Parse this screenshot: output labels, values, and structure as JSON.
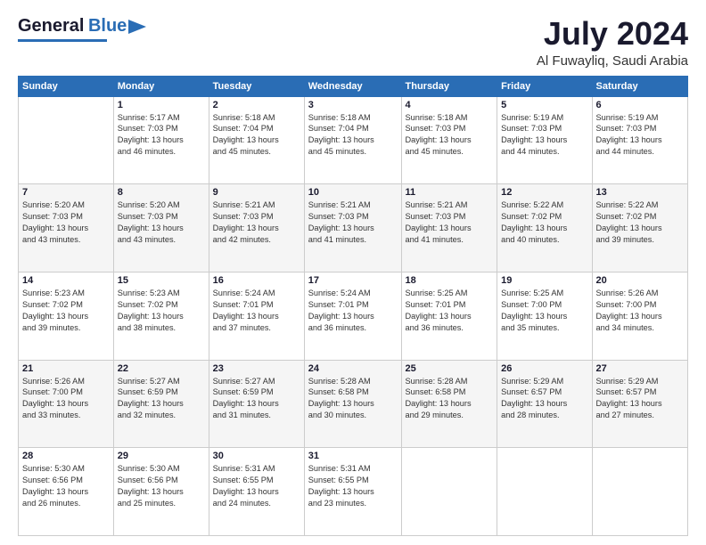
{
  "header": {
    "logo_line1": "General",
    "logo_line2": "Blue",
    "month": "July 2024",
    "location": "Al Fuwayliq, Saudi Arabia"
  },
  "days_of_week": [
    "Sunday",
    "Monday",
    "Tuesday",
    "Wednesday",
    "Thursday",
    "Friday",
    "Saturday"
  ],
  "weeks": [
    [
      {
        "day": "",
        "info": ""
      },
      {
        "day": "1",
        "info": "Sunrise: 5:17 AM\nSunset: 7:03 PM\nDaylight: 13 hours\nand 46 minutes."
      },
      {
        "day": "2",
        "info": "Sunrise: 5:18 AM\nSunset: 7:04 PM\nDaylight: 13 hours\nand 45 minutes."
      },
      {
        "day": "3",
        "info": "Sunrise: 5:18 AM\nSunset: 7:04 PM\nDaylight: 13 hours\nand 45 minutes."
      },
      {
        "day": "4",
        "info": "Sunrise: 5:18 AM\nSunset: 7:03 PM\nDaylight: 13 hours\nand 45 minutes."
      },
      {
        "day": "5",
        "info": "Sunrise: 5:19 AM\nSunset: 7:03 PM\nDaylight: 13 hours\nand 44 minutes."
      },
      {
        "day": "6",
        "info": "Sunrise: 5:19 AM\nSunset: 7:03 PM\nDaylight: 13 hours\nand 44 minutes."
      }
    ],
    [
      {
        "day": "7",
        "info": "Sunrise: 5:20 AM\nSunset: 7:03 PM\nDaylight: 13 hours\nand 43 minutes."
      },
      {
        "day": "8",
        "info": "Sunrise: 5:20 AM\nSunset: 7:03 PM\nDaylight: 13 hours\nand 43 minutes."
      },
      {
        "day": "9",
        "info": "Sunrise: 5:21 AM\nSunset: 7:03 PM\nDaylight: 13 hours\nand 42 minutes."
      },
      {
        "day": "10",
        "info": "Sunrise: 5:21 AM\nSunset: 7:03 PM\nDaylight: 13 hours\nand 41 minutes."
      },
      {
        "day": "11",
        "info": "Sunrise: 5:21 AM\nSunset: 7:03 PM\nDaylight: 13 hours\nand 41 minutes."
      },
      {
        "day": "12",
        "info": "Sunrise: 5:22 AM\nSunset: 7:02 PM\nDaylight: 13 hours\nand 40 minutes."
      },
      {
        "day": "13",
        "info": "Sunrise: 5:22 AM\nSunset: 7:02 PM\nDaylight: 13 hours\nand 39 minutes."
      }
    ],
    [
      {
        "day": "14",
        "info": "Sunrise: 5:23 AM\nSunset: 7:02 PM\nDaylight: 13 hours\nand 39 minutes."
      },
      {
        "day": "15",
        "info": "Sunrise: 5:23 AM\nSunset: 7:02 PM\nDaylight: 13 hours\nand 38 minutes."
      },
      {
        "day": "16",
        "info": "Sunrise: 5:24 AM\nSunset: 7:01 PM\nDaylight: 13 hours\nand 37 minutes."
      },
      {
        "day": "17",
        "info": "Sunrise: 5:24 AM\nSunset: 7:01 PM\nDaylight: 13 hours\nand 36 minutes."
      },
      {
        "day": "18",
        "info": "Sunrise: 5:25 AM\nSunset: 7:01 PM\nDaylight: 13 hours\nand 36 minutes."
      },
      {
        "day": "19",
        "info": "Sunrise: 5:25 AM\nSunset: 7:00 PM\nDaylight: 13 hours\nand 35 minutes."
      },
      {
        "day": "20",
        "info": "Sunrise: 5:26 AM\nSunset: 7:00 PM\nDaylight: 13 hours\nand 34 minutes."
      }
    ],
    [
      {
        "day": "21",
        "info": "Sunrise: 5:26 AM\nSunset: 7:00 PM\nDaylight: 13 hours\nand 33 minutes."
      },
      {
        "day": "22",
        "info": "Sunrise: 5:27 AM\nSunset: 6:59 PM\nDaylight: 13 hours\nand 32 minutes."
      },
      {
        "day": "23",
        "info": "Sunrise: 5:27 AM\nSunset: 6:59 PM\nDaylight: 13 hours\nand 31 minutes."
      },
      {
        "day": "24",
        "info": "Sunrise: 5:28 AM\nSunset: 6:58 PM\nDaylight: 13 hours\nand 30 minutes."
      },
      {
        "day": "25",
        "info": "Sunrise: 5:28 AM\nSunset: 6:58 PM\nDaylight: 13 hours\nand 29 minutes."
      },
      {
        "day": "26",
        "info": "Sunrise: 5:29 AM\nSunset: 6:57 PM\nDaylight: 13 hours\nand 28 minutes."
      },
      {
        "day": "27",
        "info": "Sunrise: 5:29 AM\nSunset: 6:57 PM\nDaylight: 13 hours\nand 27 minutes."
      }
    ],
    [
      {
        "day": "28",
        "info": "Sunrise: 5:30 AM\nSunset: 6:56 PM\nDaylight: 13 hours\nand 26 minutes."
      },
      {
        "day": "29",
        "info": "Sunrise: 5:30 AM\nSunset: 6:56 PM\nDaylight: 13 hours\nand 25 minutes."
      },
      {
        "day": "30",
        "info": "Sunrise: 5:31 AM\nSunset: 6:55 PM\nDaylight: 13 hours\nand 24 minutes."
      },
      {
        "day": "31",
        "info": "Sunrise: 5:31 AM\nSunset: 6:55 PM\nDaylight: 13 hours\nand 23 minutes."
      },
      {
        "day": "",
        "info": ""
      },
      {
        "day": "",
        "info": ""
      },
      {
        "day": "",
        "info": ""
      }
    ]
  ]
}
